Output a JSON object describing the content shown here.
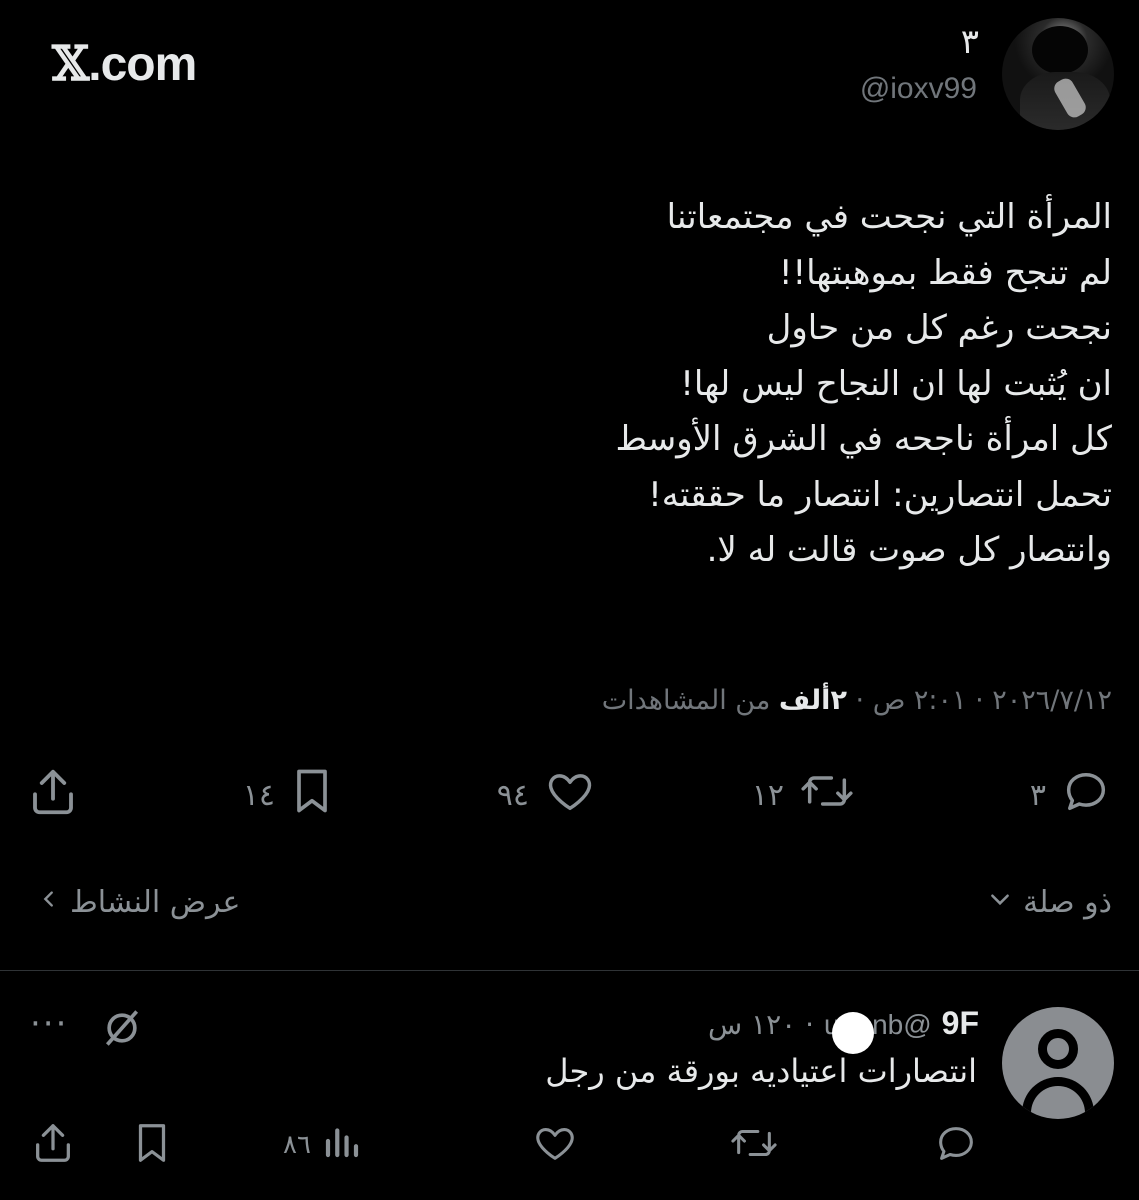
{
  "brand": {
    "logo_x": "𝕏",
    "logo_rest": ".com"
  },
  "post": {
    "display_name": "٣",
    "handle": "@ioxv99",
    "text_lines": [
      "المرأة التي نجحت في مجتمعاتنا",
      "لم تنجح فقط بموهبتها!!",
      "نجحت رغم كل من حاول",
      "ان يُثبت لها ان النجاح ليس لها!",
      "كل امرأة ناجحه في الشرق الأوسط",
      "تحمل انتصارين: انتصار ما حققته!",
      "وانتصار كل صوت قالت له لا."
    ],
    "meta": {
      "date": "٢٠٢٦/٧/١٢",
      "sep": " · ",
      "time": "٢:٠١ ص",
      "views_count": "٢ألف",
      "views_label": " من المشاهدات"
    },
    "actions": {
      "replies": "٣",
      "reposts": "١٢",
      "likes": "٩٤",
      "bookmarks": "١٤"
    },
    "related_label": "ذو صلة",
    "activity_label": "عرض النشاط"
  },
  "reply": {
    "name": "9F",
    "handle": "@u_●nb",
    "time": "١٢٠ س",
    "sep": " · ",
    "text": "انتصارات اعتياديه بورقة من رجل",
    "views": "٨٦"
  },
  "icons": {
    "reply": "speech-bubble-icon",
    "repost": "repost-arrows-icon",
    "like": "heart-icon",
    "bookmark": "bookmark-icon",
    "share": "share-upload-icon",
    "views": "bar-chart-icon",
    "more": "ellipsis-icon",
    "grok": "grok-slash-icon"
  }
}
